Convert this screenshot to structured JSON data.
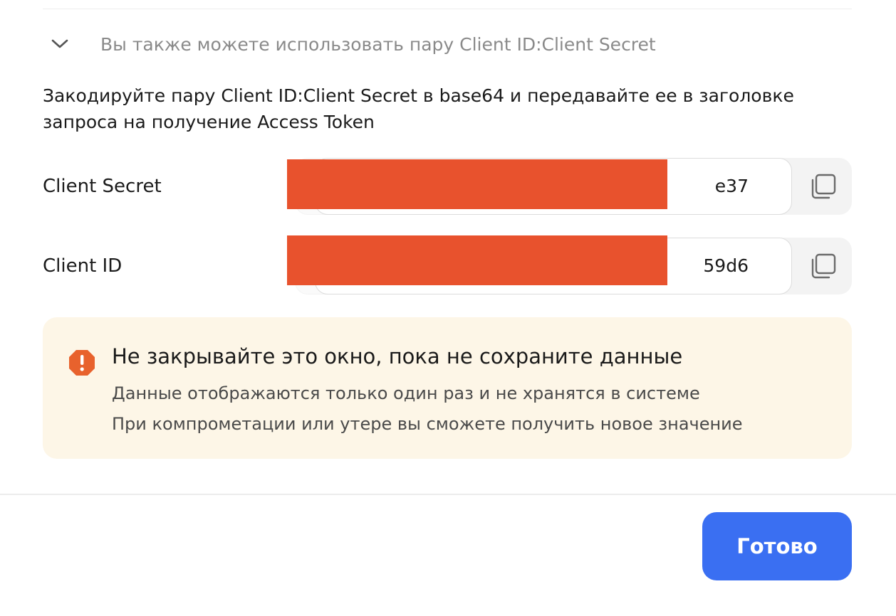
{
  "accordion": {
    "title": "Вы также можете использовать пару Client ID:Client Secret",
    "expanded": true,
    "chevron_icon": "chevron-down-icon"
  },
  "description": "Закодируйте пару Client ID:Client Secret в base64 и передавайте ее в заголовке запроса на получение Access Token",
  "fields": [
    {
      "label": "Client Secret",
      "value_visible_suffix": "e37",
      "copy_icon": "copy-icon"
    },
    {
      "label": "Client ID",
      "value_visible_suffix": "59d6",
      "copy_icon": "copy-icon"
    }
  ],
  "redaction_color": "#e8522d",
  "warning": {
    "icon": "warning-octagon-icon",
    "icon_color": "#e8622d",
    "background": "#fdf6e7",
    "title": "Не закрывайте это окно, пока не сохраните данные",
    "lines": [
      "Данные отображаются только один раз и не хранятся в системе",
      "При компрометации или утере вы сможете получить новое значение"
    ]
  },
  "footer": {
    "done_label": "Готово",
    "accent": "#3a6ff2"
  }
}
